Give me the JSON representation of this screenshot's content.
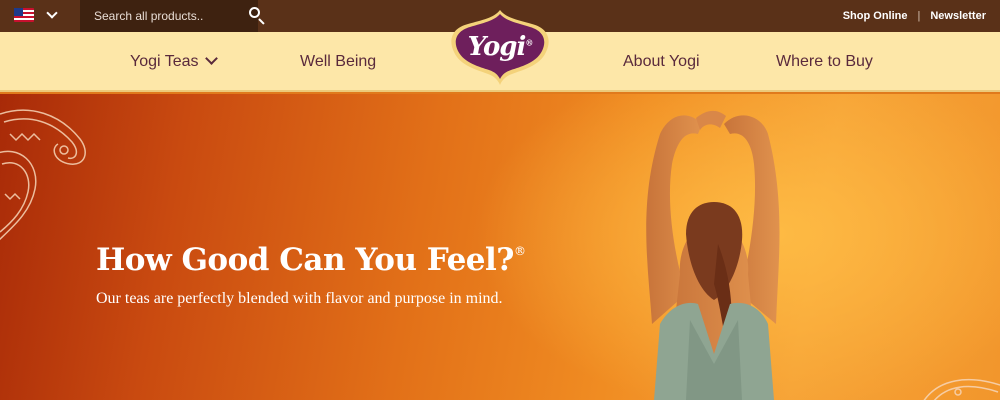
{
  "topbar": {
    "flag_icon": "us-flag-icon",
    "search_placeholder": "Search all products..",
    "links": [
      "Shop Online",
      "Newsletter"
    ],
    "separator": "|"
  },
  "nav": {
    "items": [
      "Yogi Teas",
      "Well Being",
      "About Yogi",
      "Where to Buy"
    ],
    "logo_text": "Yogi",
    "logo_mark": "®"
  },
  "hero": {
    "title": "How Good Can You Feel?",
    "title_mark": "®",
    "subtitle": "Our teas are perfectly blended with flavor and purpose in mind."
  },
  "colors": {
    "topbar": "#5a3118",
    "navbar": "#fde7a8",
    "nav_text": "#5a2a3c",
    "logo_purple": "#6e1f5c",
    "hero_orange": "#f08c22"
  }
}
